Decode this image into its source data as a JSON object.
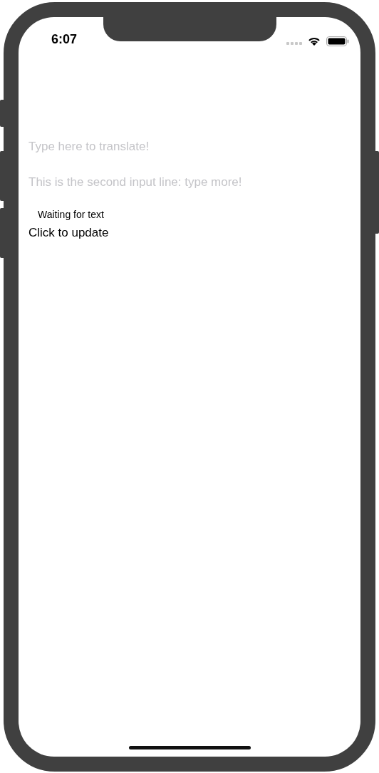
{
  "status_bar": {
    "time": "6:07"
  },
  "fields": [
    {
      "placeholder": "Type here to translate!"
    },
    {
      "placeholder": "This is the second input line: type more!"
    }
  ],
  "status_label": "Waiting for text",
  "update_button": {
    "label": "Click to update"
  }
}
